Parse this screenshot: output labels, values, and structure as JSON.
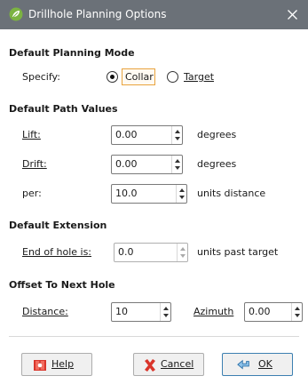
{
  "window": {
    "title": "Drillhole Planning Options",
    "close_symbol": "×"
  },
  "planning_mode": {
    "heading": "Default Planning Mode",
    "specify_label": "Specify:",
    "options": [
      "Collar",
      "Target"
    ],
    "selected": "Collar"
  },
  "path_values": {
    "heading": "Default Path Values",
    "lift": {
      "label": "Lift:",
      "value": "0.00",
      "unit": "degrees"
    },
    "drift": {
      "label": "Drift:",
      "value": "0.00",
      "unit": "degrees"
    },
    "per": {
      "label": "per:",
      "value": "10.0",
      "unit": "units distance"
    }
  },
  "extension": {
    "heading": "Default Extension",
    "label": "End of hole is:",
    "value": "0.0",
    "unit": "units past target"
  },
  "offset": {
    "heading": "Offset To Next Hole",
    "distance_label": "Distance:",
    "distance_value": "10",
    "azimuth_label": "Azimuth",
    "azimuth_value": "0.00"
  },
  "buttons": {
    "help": "Help",
    "cancel": "Cancel",
    "ok": "OK"
  },
  "colors": {
    "titlebar": "#6b7178",
    "focus_outline": "#e8a33d",
    "app_icon": "#7cb342"
  },
  "icons": [
    "app-leaf-icon",
    "close-icon",
    "help-book-icon",
    "cancel-x-icon",
    "ok-return-icon"
  ]
}
